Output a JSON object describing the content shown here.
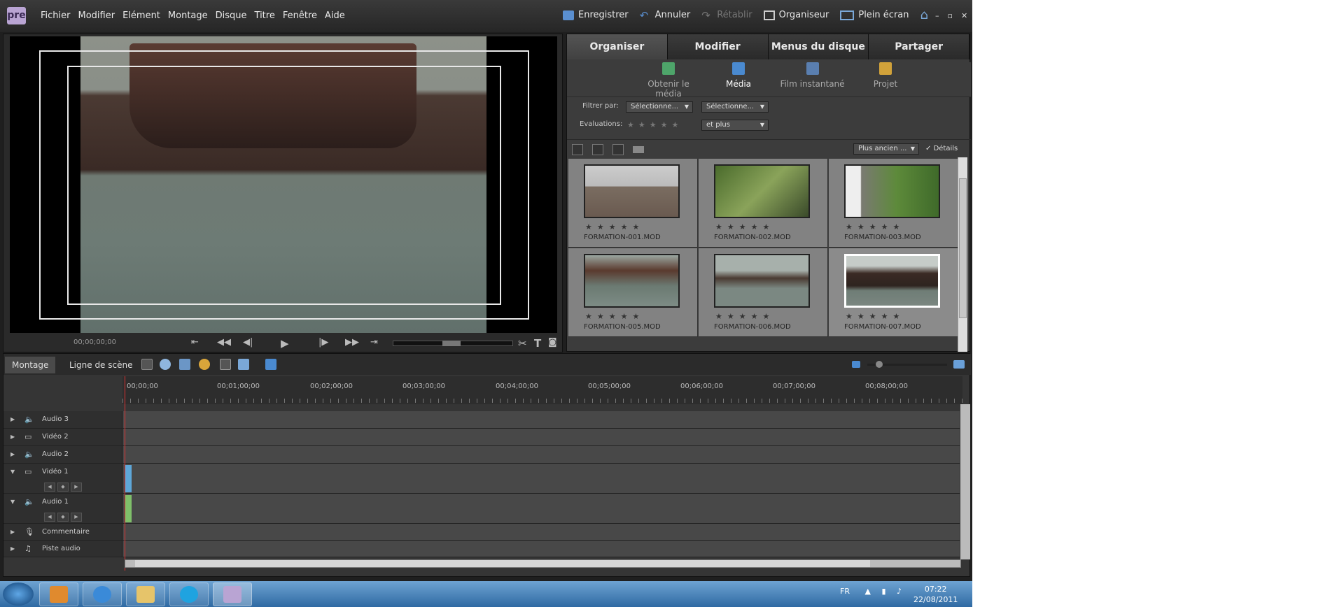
{
  "menubar": {
    "logo": "pre",
    "menus": [
      "Fichier",
      "Modifier",
      "Elément",
      "Montage",
      "Disque",
      "Titre",
      "Fenêtre",
      "Aide"
    ],
    "actions": {
      "save": "Enregistrer",
      "undo": "Annuler",
      "redo": "Rétablir",
      "organizer": "Organiseur",
      "fullscreen": "Plein écran"
    }
  },
  "monitor": {
    "timecode": "00;00;00;00"
  },
  "panel": {
    "tabs": [
      "Organiser",
      "Modifier",
      "Menus du disque",
      "Partager"
    ],
    "active_tab": "Organiser",
    "subtabs": [
      "Obtenir le média",
      "Média",
      "Film instantané",
      "Projet"
    ],
    "active_subtab": "Média",
    "filter_label": "Filtrer par:",
    "filter1": "Sélectionne...",
    "filter2": "Sélectionne...",
    "ratings_label": "Evaluations:",
    "ratings_filter": "et plus",
    "sort": "Plus ancien ...",
    "details": "Détails",
    "media": [
      {
        "name": "FORMATION-001.MOD",
        "selected": false
      },
      {
        "name": "FORMATION-002.MOD",
        "selected": false
      },
      {
        "name": "FORMATION-003.MOD",
        "selected": false
      },
      {
        "name": "FORMATION-005.MOD",
        "selected": false
      },
      {
        "name": "FORMATION-006.MOD",
        "selected": false
      },
      {
        "name": "FORMATION-007.MOD",
        "selected": true
      }
    ]
  },
  "timeline": {
    "tabs": [
      "Montage",
      "Ligne de scène"
    ],
    "active_tab": "Montage",
    "ruler": [
      "00;00;00",
      "00;01;00;00",
      "00;02;00;00",
      "00;03;00;00",
      "00;04;00;00",
      "00;05;00;00",
      "00;06;00;00",
      "00;07;00;00",
      "00;08;00;00"
    ],
    "tracks": [
      "Audio 3",
      "Vidéo 2",
      "Audio 2",
      "Vidéo 1",
      "Audio 1",
      "Commentaire",
      "Piste audio"
    ]
  },
  "taskbar": {
    "lang": "FR",
    "time": "07:22",
    "date": "22/08/2011"
  }
}
